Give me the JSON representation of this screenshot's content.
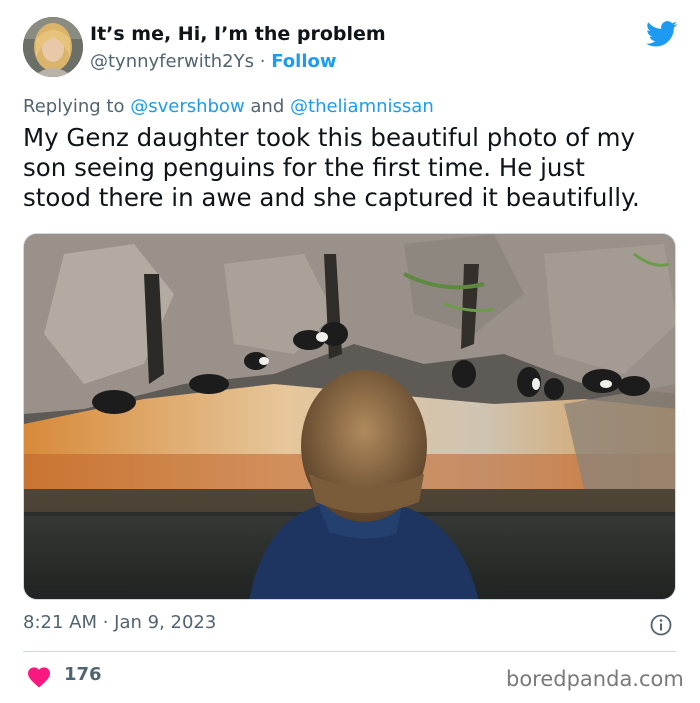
{
  "tweet": {
    "author": {
      "display_name": "It’s me, Hi, I’m the problem",
      "handle": "@tynnyferwith2Ys",
      "separator": "·",
      "follow_label": "Follow",
      "avatar_icon": "profile-photo"
    },
    "platform_icon": "twitter-bird-icon",
    "reply_context": {
      "prefix": "Replying to",
      "mentions": [
        "@svershbow",
        "@theliamnissan"
      ],
      "joiner": "and"
    },
    "text_lines": [
      "My Genz daughter took this beautiful photo of my",
      "son seeing penguins for the first time. He just",
      "stood there in awe and she captured it beautifully."
    ],
    "photo_description_icon": "boy-watching-penguins-photo",
    "timestamp": "8:21 AM · Jan 9, 2023",
    "info_icon": "info-icon",
    "likes": {
      "icon": "heart-icon",
      "count": "176"
    }
  },
  "watermark": "boredpanda.com",
  "colors": {
    "accent": "#1d9bf0",
    "like": "#f91880",
    "secondary_text": "#536471",
    "primary_text": "#0f1419"
  }
}
